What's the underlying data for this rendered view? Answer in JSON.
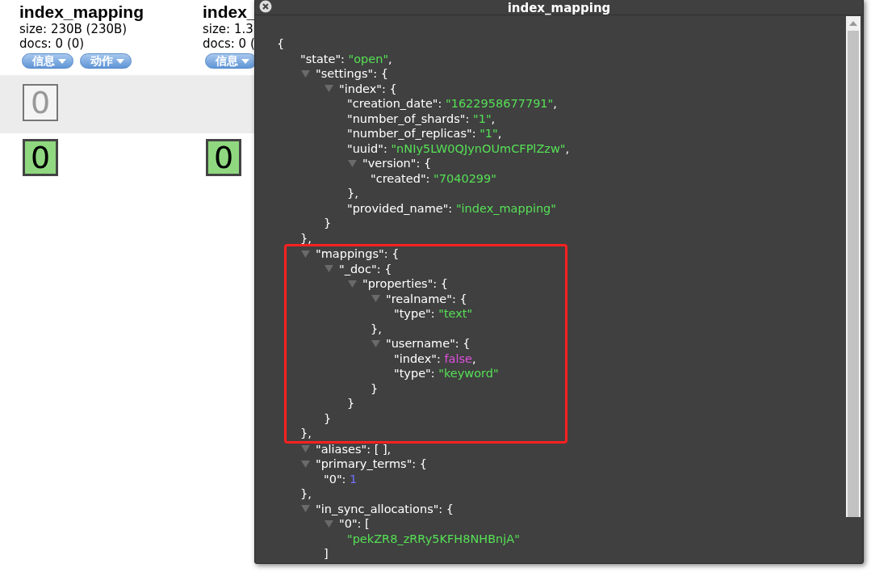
{
  "indices": [
    {
      "title": "index_mapping",
      "size": "size: 230B (230B)",
      "docs": "docs: 0 (0)",
      "buttons": [
        "信息",
        "动作"
      ],
      "primary_shards": [
        {
          "label": "0",
          "kind": "unassigned"
        }
      ],
      "replica_shards": [
        {
          "label": "0",
          "kind": "started"
        }
      ]
    },
    {
      "title": "index_",
      "size": "size: 1.3",
      "docs": "docs: 0 (",
      "buttons": [
        "信息"
      ],
      "replica_shards": [
        {
          "label": "0",
          "kind": "started"
        }
      ]
    }
  ],
  "modal": {
    "title": "index_mapping",
    "tree": {
      "label": "{",
      "children": [
        {
          "label": "\"state\": ",
          "value": "\"open\"",
          "kind": "string",
          "after": ","
        },
        {
          "label": "\"settings\": {",
          "expanded": true,
          "close": "},",
          "children": [
            {
              "label": "\"index\": {",
              "expanded": true,
              "close": "}",
              "children": [
                {
                  "label": "\"creation_date\": ",
                  "value": "\"1622958677791\"",
                  "kind": "string",
                  "after": ","
                },
                {
                  "label": "\"number_of_shards\": ",
                  "value": "\"1\"",
                  "kind": "string",
                  "after": ","
                },
                {
                  "label": "\"number_of_replicas\": ",
                  "value": "\"1\"",
                  "kind": "string",
                  "after": ","
                },
                {
                  "label": "\"uuid\": ",
                  "value": "\"nNIy5LW0QJynOUmCFPlZzw\"",
                  "kind": "string",
                  "after": ","
                },
                {
                  "label": "\"version\": {",
                  "expanded": true,
                  "close": "},",
                  "children": [
                    {
                      "label": "\"created\": ",
                      "value": "\"7040299\"",
                      "kind": "string"
                    }
                  ]
                },
                {
                  "label": "\"provided_name\": ",
                  "value": "\"index_mapping\"",
                  "kind": "string"
                }
              ]
            }
          ]
        },
        {
          "label": "\"mappings\": {",
          "expanded": true,
          "highlighted": true,
          "close": "},",
          "children": [
            {
              "label": "\"_doc\": {",
              "expanded": true,
              "close": "}",
              "children": [
                {
                  "label": "\"properties\": {",
                  "expanded": true,
                  "close": "}",
                  "children": [
                    {
                      "label": "\"realname\": {",
                      "expanded": true,
                      "close": "},",
                      "children": [
                        {
                          "label": "\"type\": ",
                          "value": "\"text\"",
                          "kind": "string"
                        }
                      ]
                    },
                    {
                      "label": "\"username\": {",
                      "expanded": true,
                      "close": "}",
                      "children": [
                        {
                          "label": "\"index\": ",
                          "value": "false",
                          "kind": "boolean",
                          "after": ","
                        },
                        {
                          "label": "\"type\": ",
                          "value": "\"keyword\"",
                          "kind": "string"
                        }
                      ]
                    }
                  ]
                }
              ]
            }
          ]
        },
        {
          "label": "\"aliases\": [ ],",
          "expanded": true
        },
        {
          "label": "\"primary_terms\": {",
          "expanded": true,
          "close": "},",
          "children": [
            {
              "label": "\"0\": ",
              "value": "1",
              "kind": "number"
            }
          ]
        },
        {
          "label": "\"in_sync_allocations\": {",
          "expanded": true,
          "children": [
            {
              "label": "\"0\": [",
              "expanded": true,
              "close": "]",
              "children": [
                {
                  "value": "\"pekZR8_zRRy5KFH8NHBnjA\"",
                  "kind": "string"
                }
              ]
            }
          ]
        }
      ]
    }
  }
}
